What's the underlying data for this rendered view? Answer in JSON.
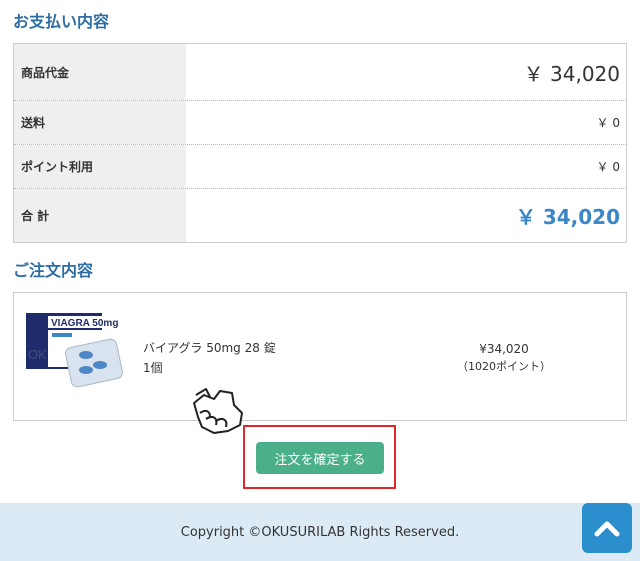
{
  "payment": {
    "title": "お支払い内容",
    "rows": [
      {
        "label": "商品代金",
        "value": "￥ 34,020"
      },
      {
        "label": "送料",
        "value": "￥ 0"
      },
      {
        "label": "ポイント利用",
        "value": "￥ 0"
      },
      {
        "label": "合 計",
        "value": "￥ 34,020"
      }
    ]
  },
  "order": {
    "title": "ご注文内容",
    "item": {
      "name": "バイアグラ 50mg 28 錠",
      "quantity": "1個",
      "price": "¥34,020",
      "points": "（1020ポイント）",
      "image_alt_text": "VIAGRA 50mg"
    }
  },
  "confirm_button": {
    "label": "注文を確定する"
  },
  "footer": {
    "copyright": "Copyright ©OKUSURILAB Rights Reserved."
  },
  "icons": {
    "back_to_top": "chevron-up-icon",
    "pointer": "hand-pointer-icon"
  },
  "colors": {
    "section_title": "#2f6ea5",
    "total": "#3a86c8",
    "button": "#4bb08a",
    "highlight": "#e0262b",
    "footer_bg": "#dbeaf5",
    "to_top_bg": "#2a8fcc"
  }
}
